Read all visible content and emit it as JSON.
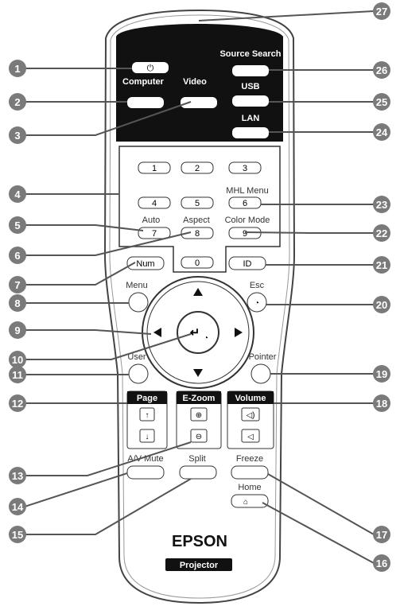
{
  "remote": {
    "labels": {
      "source_search": "Source Search",
      "computer": "Computer",
      "video": "Video",
      "usb": "USB",
      "lan": "LAN",
      "mhl_menu": "MHL Menu",
      "auto": "Auto",
      "aspect": "Aspect",
      "color_mode": "Color Mode",
      "num": "Num",
      "id": "ID",
      "menu": "Menu",
      "esc": "Esc",
      "user": "User",
      "pointer": "Pointer",
      "page": "Page",
      "ezoom": "E-Zoom",
      "volume": "Volume",
      "av_mute": "A/V Mute",
      "split": "Split",
      "freeze": "Freeze",
      "home": "Home"
    },
    "keys": [
      "1",
      "2",
      "3",
      "4",
      "5",
      "6",
      "7",
      "8",
      "9",
      "0"
    ],
    "brand": "EPSON",
    "product": "Projector",
    "power_symbol": "⏻"
  },
  "callouts": [
    "1",
    "2",
    "3",
    "4",
    "5",
    "6",
    "7",
    "8",
    "9",
    "10",
    "11",
    "12",
    "13",
    "14",
    "15",
    "16",
    "17",
    "18",
    "19",
    "20",
    "21",
    "22",
    "23",
    "24",
    "25",
    "26",
    "27"
  ],
  "colors": {
    "callout": "#7a7a7a",
    "line": "#555555",
    "dark_panel": "#111111",
    "button_outline": "#333333"
  }
}
